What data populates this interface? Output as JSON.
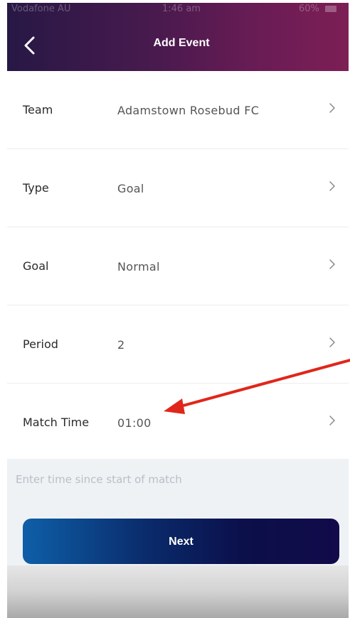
{
  "status_bar": {
    "carrier": "Vodafone AU",
    "time": "1:46 am",
    "battery": "60%"
  },
  "header": {
    "title": "Add Event",
    "back_icon": "chevron-left-icon",
    "gradient_start": "#271845",
    "gradient_end": "#7c1f55"
  },
  "rows": [
    {
      "label": "Team",
      "value": "Adamstown Rosebud FC"
    },
    {
      "label": "Type",
      "value": "Goal"
    },
    {
      "label": "Goal",
      "value": "Normal"
    },
    {
      "label": "Period",
      "value": "2"
    },
    {
      "label": "Match Time",
      "value": "01:00"
    }
  ],
  "hint": {
    "text": "Enter time since start of match"
  },
  "next_button": {
    "label": "Next"
  },
  "annotation": {
    "arrow_color": "#e0261b",
    "icon": "red-arrow-annotation"
  }
}
